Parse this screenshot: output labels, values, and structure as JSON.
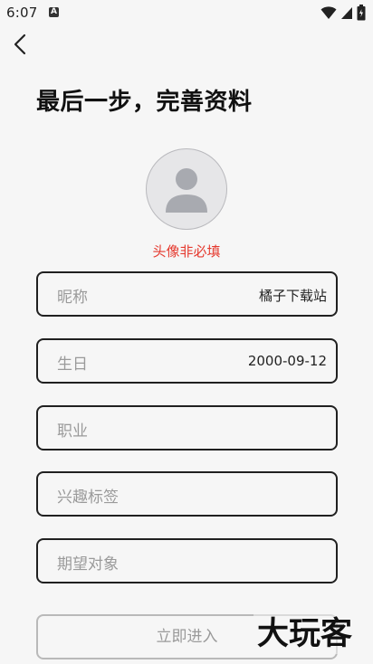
{
  "status_bar": {
    "time": "6:07",
    "notification_glyph": "A",
    "icons": [
      "wifi-icon",
      "signal-icon",
      "battery-icon"
    ]
  },
  "header": {
    "back_icon": "chevron-left-icon",
    "title": "最后一步，完善资料"
  },
  "avatar": {
    "icon": "person-icon",
    "hint": "头像非必填"
  },
  "form": {
    "nickname": {
      "label": "昵称",
      "value": "橘子下载站"
    },
    "birthday": {
      "label": "生日",
      "value": "2000-09-12"
    },
    "occupation": {
      "label": "职业",
      "value": ""
    },
    "interest_tags": {
      "label": "兴趣标签",
      "value": ""
    },
    "expected_partner": {
      "label": "期望对象",
      "value": ""
    }
  },
  "submit": {
    "label": "立即进入"
  },
  "watermark": "大玩客",
  "colors": {
    "background": "#f6f6f6",
    "hint_red": "#e53a2f",
    "border_dark": "#202020",
    "placeholder_gray": "#9a9a9a"
  }
}
